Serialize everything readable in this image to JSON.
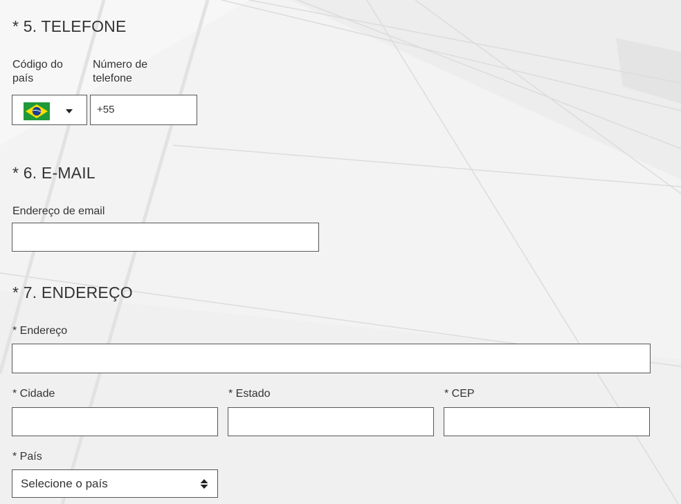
{
  "phone_section": {
    "title": "* 5. TELEFONE",
    "country_code_label_line1": "Código do",
    "country_code_label_line2": "país",
    "number_label_line1": "Número de",
    "number_label_line2": "telefone",
    "country_flag": "brazil-flag",
    "number_value": "+55"
  },
  "email_section": {
    "title": "* 6. E-MAIL",
    "email_label": "Endereço de email",
    "email_value": ""
  },
  "address_section": {
    "title": "* 7. ENDEREÇO",
    "address_label": "* Endereço",
    "city_label": "* Cidade",
    "state_label": "* Estado",
    "zip_label": "* CEP",
    "country_label": "*  País",
    "country_select_value": "Selecione o país"
  },
  "colors": {
    "background": "#f3f3f3",
    "field_border": "#555555",
    "flag_green": "#1f9a3a",
    "flag_yellow": "#ffdf00",
    "flag_blue": "#1c3f94"
  }
}
